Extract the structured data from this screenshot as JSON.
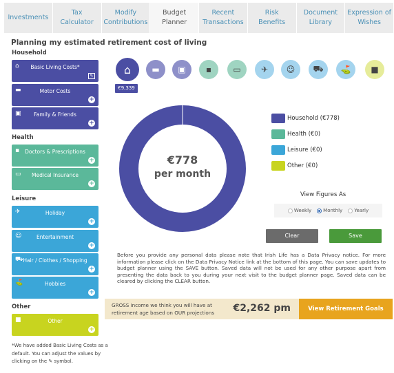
{
  "tabs": [
    {
      "label": "Investments"
    },
    {
      "label": "Tax\nCalculator"
    },
    {
      "label": "Modify\nContributions"
    },
    {
      "label": "Budget\nPlanner"
    },
    {
      "label": "Recent\nTransactions"
    },
    {
      "label": "Risk\nBenefits"
    },
    {
      "label": "Document\nLibrary"
    },
    {
      "label": "Expression of\nWishes"
    }
  ],
  "page_title": "Planning my estimated retirement cost of living",
  "sections": {
    "household": "Household",
    "health": "Health",
    "leisure": "Leisure",
    "other": "Other"
  },
  "categories": {
    "basic_living": "Basic Living Costs*",
    "motor": "Motor Costs",
    "family": "Family & Friends",
    "doctors": "Doctors & Prescriptions",
    "medical_insurance": "Medical Insurance",
    "holiday": "Holiday",
    "entertainment": "Entertainment",
    "hair": "Hair / Clothes / Shopping",
    "hobbies": "Hobbies",
    "other": "Other"
  },
  "footnote": "*We have added Basic Living Costs as a default. You can adjust the values by clicking on the ✎ symbol.",
  "selected_badge": "€9,339",
  "donut": {
    "amount": "€778",
    "period": "per month"
  },
  "legend": [
    {
      "label": "Household (€778)",
      "color": "#4b4ea3",
      "value": 778
    },
    {
      "label": "Health (€0)",
      "color": "#5bb89a",
      "value": 0
    },
    {
      "label": "Leisure (€0)",
      "color": "#3ba6d8",
      "value": 0
    },
    {
      "label": "Other (€0)",
      "color": "#c8d41f",
      "value": 0
    }
  ],
  "view_figures": {
    "title": "View Figures As",
    "options": [
      "Weekly",
      "Monthly",
      "Yearly"
    ],
    "selected": "Monthly"
  },
  "buttons": {
    "clear": "Clear",
    "save": "Save",
    "goals": "View Retirement Goals"
  },
  "notice": "Before you provide any personal data please note that Irish Life has a Data Privacy notice. For more information please click on the Data Privacy Notice link at the bottom of this page. You can save updates to budget planner using the SAVE button. Saved data will not be used for any other purpose apart from presenting the data back to you during your next visit to the budget planner page. Saved data can be cleared by clicking the CLEAR button.",
  "gross": {
    "text": "GROSS income we think you will have at retirement age based on OUR projections",
    "value": "€2,262 pm"
  },
  "colors": {
    "household": "#4b4ea3",
    "health": "#5bb89a",
    "leisure": "#3ba6d8",
    "other": "#c8d41f",
    "goals": "#e8a41e",
    "save": "#4a9a3b"
  }
}
